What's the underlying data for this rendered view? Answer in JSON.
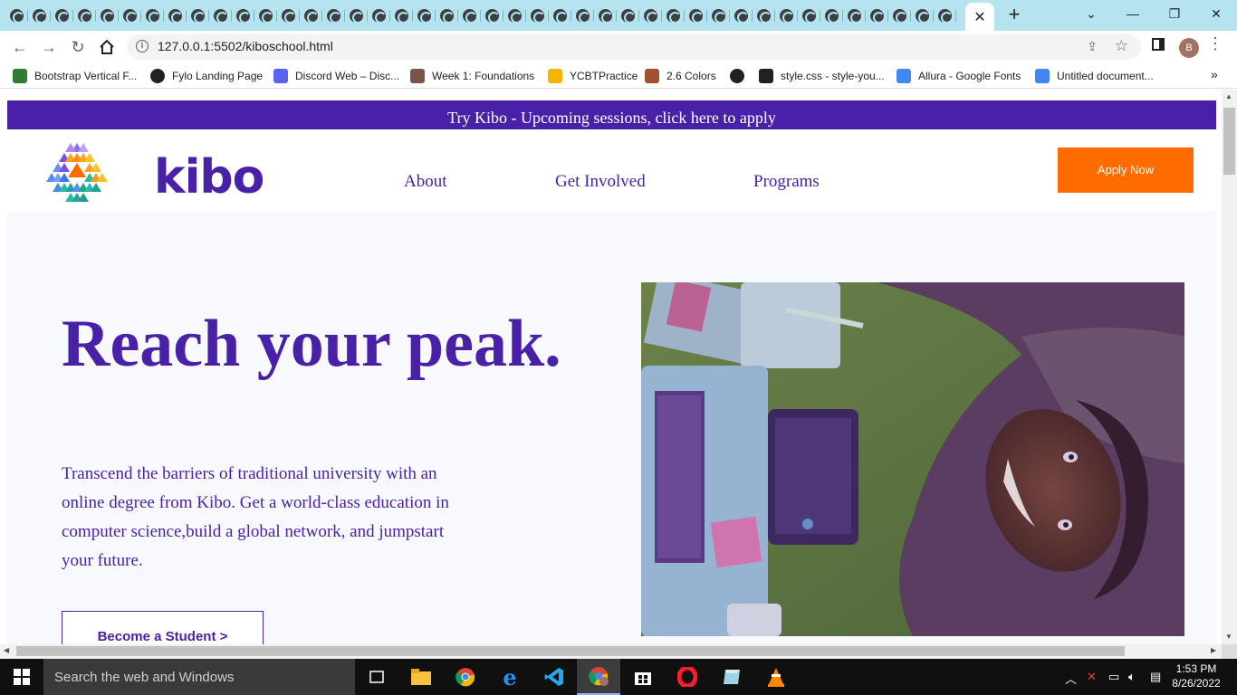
{
  "browser": {
    "tab_close_glyph": "✕",
    "new_tab_glyph": "+",
    "url": "127.0.0.1:5502/kiboschool.html",
    "window_controls": {
      "minimize": "—",
      "maximize": "❐",
      "close": "✕"
    },
    "avatar_letter": "B",
    "bookmarks": [
      {
        "label": "Bootstrap Vertical F...",
        "icon": "bootstrap-icon",
        "color": "#2e7d32"
      },
      {
        "label": "Fylo Landing Page",
        "icon": "codepen-icon",
        "color": "#202124"
      },
      {
        "label": "Discord Web – Disc...",
        "icon": "discord-icon",
        "color": "#5865f2"
      },
      {
        "label": "Week 1: Foundations",
        "icon": "tools-icon",
        "color": "#795548"
      },
      {
        "label": "YCBTPractice",
        "icon": "ycombinator-icon",
        "color": "#f4b400"
      },
      {
        "label": "2.6 Colors",
        "icon": "user-icon",
        "color": "#a0522d"
      },
      {
        "label": "",
        "icon": "globe-icon",
        "color": "#202124"
      },
      {
        "label": "style.css - style-you...",
        "icon": "codesandbox-icon",
        "color": "#202124"
      },
      {
        "label": "Allura - Google Fonts",
        "icon": "google-fonts-icon",
        "color": "#4285f4"
      },
      {
        "label": "Untitled document...",
        "icon": "google-docs-icon",
        "color": "#4285f4"
      }
    ],
    "bookmarks_more": "»"
  },
  "page": {
    "banner_text": "Try Kibo - Upcoming sessions, click here to apply",
    "logo_text": "kibo",
    "nav": [
      "About",
      "Get Involved",
      "Programs"
    ],
    "apply_button": "Apply Now",
    "hero_title": "Reach your peak.",
    "hero_copy": "Transcend the barriers of traditional university with an online degree from Kibo. Get a world-class education in computer science,build a global network, and jumpstart your future.",
    "student_button": "Become a Student >",
    "colors": {
      "brand_purple": "#4821a8",
      "cta_orange": "#fe6c00",
      "hero_bg": "#f8f9fd"
    }
  },
  "taskbar": {
    "search_placeholder": "Search the web and Windows",
    "time": "1:53 PM",
    "date": "8/26/2022"
  }
}
